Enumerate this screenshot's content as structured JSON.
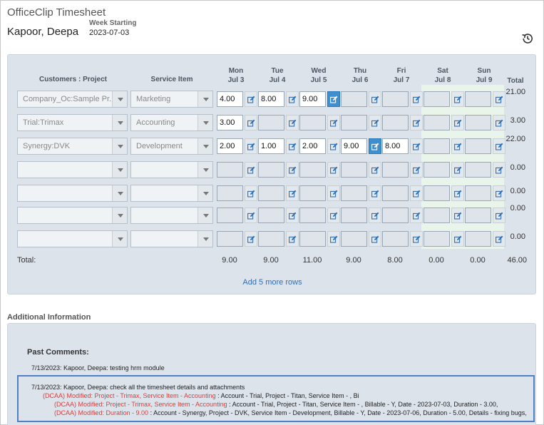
{
  "app": {
    "title": "OfficeClip Timesheet"
  },
  "employee": {
    "name": "Kapoor, Deepa"
  },
  "week": {
    "label": "Week Starting",
    "value": "2023-07-03"
  },
  "grid": {
    "headers": {
      "customer": "Customers : Project",
      "service": "Service Item",
      "total": "Total"
    },
    "days": [
      {
        "day": "Mon",
        "date": "Jul 3"
      },
      {
        "day": "Tue",
        "date": "Jul 4"
      },
      {
        "day": "Wed",
        "date": "Jul 5"
      },
      {
        "day": "Thu",
        "date": "Jul 6"
      },
      {
        "day": "Fri",
        "date": "Jul 7"
      },
      {
        "day": "Sat",
        "date": "Jul 8"
      },
      {
        "day": "Sun",
        "date": "Jul 9"
      }
    ],
    "rows": [
      {
        "customer": "Company_Oc:Sample Pr...",
        "service": "Marketing",
        "hours": [
          "4.00",
          "8.00",
          "9.00",
          "",
          "",
          "",
          ""
        ],
        "total": "21.00"
      },
      {
        "customer": "Trial:Trimax",
        "service": "Accounting",
        "hours": [
          "3.00",
          "",
          "",
          "",
          "",
          "",
          ""
        ],
        "total": "3.00"
      },
      {
        "customer": "Synergy:DVK",
        "service": "Development",
        "hours": [
          "2.00",
          "1.00",
          "2.00",
          "9.00",
          "8.00",
          "",
          ""
        ],
        "total": "22.00"
      },
      {
        "customer": "",
        "service": "",
        "hours": [
          "",
          "",
          "",
          "",
          "",
          "",
          ""
        ],
        "total": "0.00"
      },
      {
        "customer": "",
        "service": "",
        "hours": [
          "",
          "",
          "",
          "",
          "",
          "",
          ""
        ],
        "total": "0.00"
      },
      {
        "customer": "",
        "service": "",
        "hours": [
          "",
          "",
          "",
          "",
          "",
          "",
          ""
        ],
        "total": "0.00"
      },
      {
        "customer": "",
        "service": "",
        "hours": [
          "",
          "",
          "",
          "",
          "",
          "",
          ""
        ],
        "total": "0.00"
      }
    ],
    "totals_label": "Total:",
    "day_totals": [
      "9.00",
      "9.00",
      "11.00",
      "9.00",
      "8.00",
      "0.00",
      "0.00"
    ],
    "grand_total": "46.00",
    "add_rows": "Add 5 more rows"
  },
  "additional": {
    "title": "Additional Information",
    "past_title": "Past Comments:",
    "comment1": "7/13/2023: Kapoor, Deepa: testing hrm module",
    "comment2_head": "7/13/2023: Kapoor, Deepa: check all the timesheet details and attachments",
    "log": [
      {
        "tag": "(DCAA) Modified: Project - Trimax, Service Item - Accounting",
        "rest": " : Account - Trial, Project - Titan, Service Item - , Bi"
      },
      {
        "tag": "(DCAA) Modified: Project - Trimax, Service Item - Accounting",
        "rest": " : Account - Trial, Project - Titan, Service Item - , Billable - Y, Date - 2023-07-03, Duration - 3.00,"
      },
      {
        "tag": "(DCAA) Modified: Duration - 9.00",
        "rest": " : Account - Synergy, Project - DVK, Service Item - Development, Billable - Y, Date - 2023-07-06, Duration - 5.00, Details - fixing bugs,"
      }
    ]
  },
  "colors": {
    "accent": "#3d8fd0",
    "log_red": "#e03b3b",
    "panel": "#dde3ea",
    "link": "#2f6fb3"
  }
}
